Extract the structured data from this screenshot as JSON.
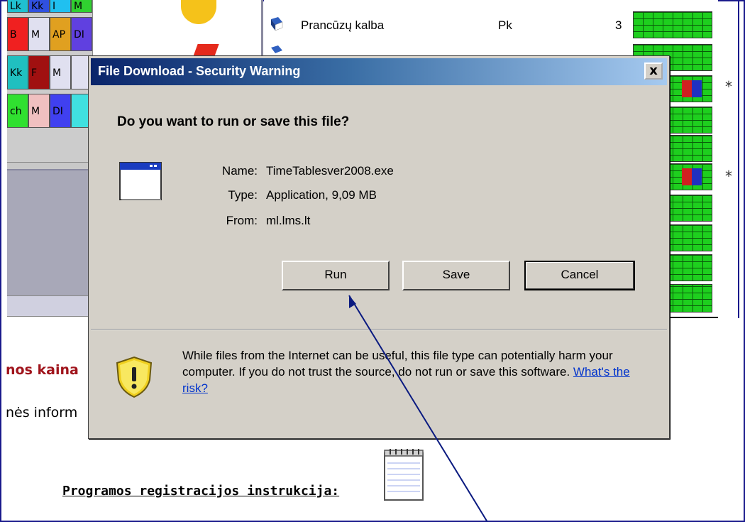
{
  "grid_cells": [
    {
      "t": "Lk",
      "bg": "#20c0d0"
    },
    {
      "t": "Kk",
      "bg": "#3050e0"
    },
    {
      "t": "I",
      "bg": "#20c0f0"
    },
    {
      "t": "M",
      "bg": "#30d030"
    },
    {
      "t": "B",
      "bg": "#f02020"
    },
    {
      "t": "M",
      "bg": "#e0e0f0"
    },
    {
      "t": "AP",
      "bg": "#e0a020"
    },
    {
      "t": "DI",
      "bg": "#6040e0"
    },
    {
      "t": "Kk",
      "bg": "#20c0c0"
    },
    {
      "t": "F",
      "bg": "#a01010"
    },
    {
      "t": "M",
      "bg": "#e0e0f0"
    },
    {
      "t": "",
      "bg": "#e0e0f0"
    },
    {
      "t": "ch",
      "bg": "#30e030"
    },
    {
      "t": "M",
      "bg": "#f0c0c0"
    },
    {
      "t": "DI",
      "bg": "#4040f0"
    },
    {
      "t": "",
      "bg": "#40e0e0"
    }
  ],
  "list_rows": [
    {
      "name": "Prancūzų kalba",
      "code": "Pk",
      "num": "3"
    }
  ],
  "stars": [
    "*",
    "*"
  ],
  "dialog": {
    "title": "File Download - Security Warning",
    "close": "x",
    "question": "Do you want to run or save this file?",
    "name_label": "Name:",
    "name_value": "TimeTablesver2008.exe",
    "type_label": "Type:",
    "type_value": "Application, 9,09 MB",
    "from_label": "From:",
    "from_value": "ml.lms.lt",
    "run": "Run",
    "save": "Save",
    "cancel": "Cancel",
    "warning": "While files from the Internet can be useful, this file type can potentially harm your computer. If you do not trust the source, do not run or save this software.",
    "risk_link": "What's the risk?"
  },
  "page": {
    "price_heading": "nos kaina",
    "info_text": "nės inform",
    "reg_link": "Programos registracijos instrukcija:"
  },
  "colors": {
    "title_start": "#0a246a",
    "title_end": "#a6caf0",
    "dialog_bg": "#d4d0c8",
    "bar_green": "#1ecf1e",
    "heading_red": "#a0141c",
    "link_blue": "#0033cc"
  }
}
